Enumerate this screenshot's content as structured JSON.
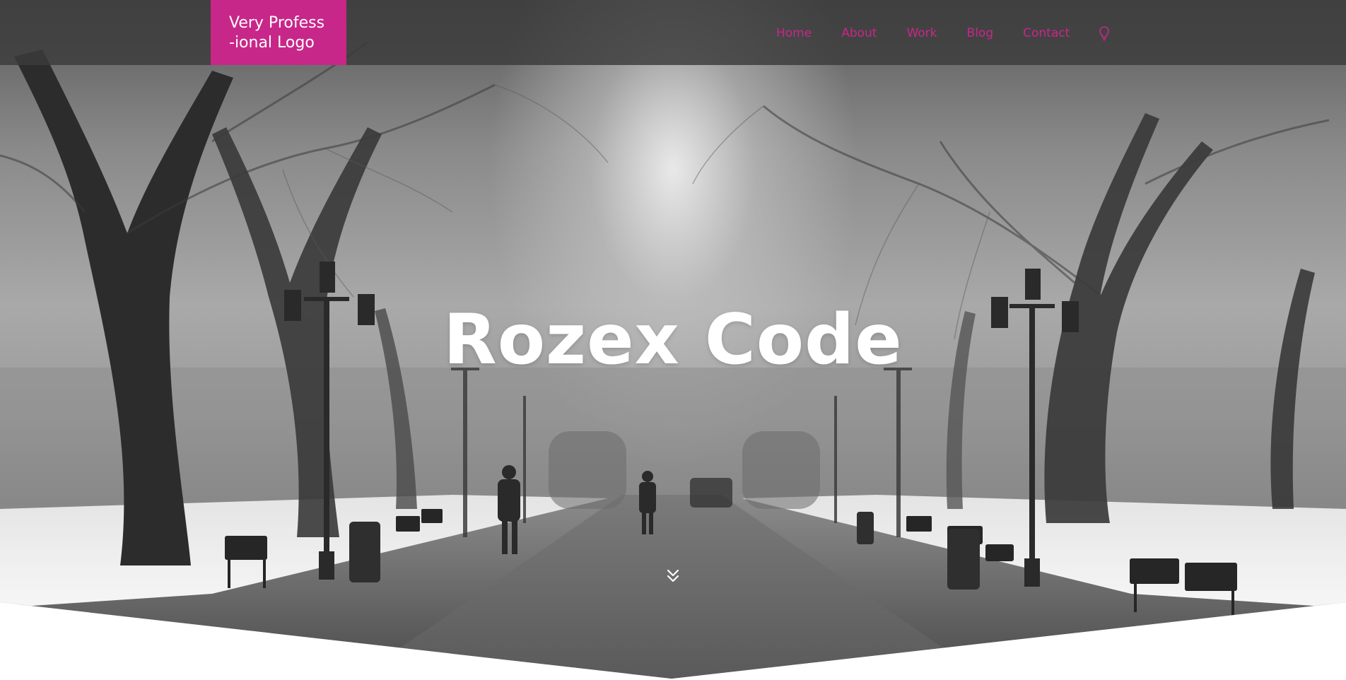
{
  "logo": {
    "line1": "Very Profess",
    "line2": "-ional Logo"
  },
  "nav": {
    "items": [
      {
        "label": "Home"
      },
      {
        "label": "About"
      },
      {
        "label": "Work"
      },
      {
        "label": "Blog"
      },
      {
        "label": "Contact"
      }
    ],
    "theme_toggle_icon": "lightbulb-icon"
  },
  "hero": {
    "title": "Rozex Code",
    "scroll_icon": "double-chevron-down-icon"
  },
  "colors": {
    "accent": "#c8278a",
    "topbar": "#3a3a3a",
    "title": "#ffffff"
  }
}
